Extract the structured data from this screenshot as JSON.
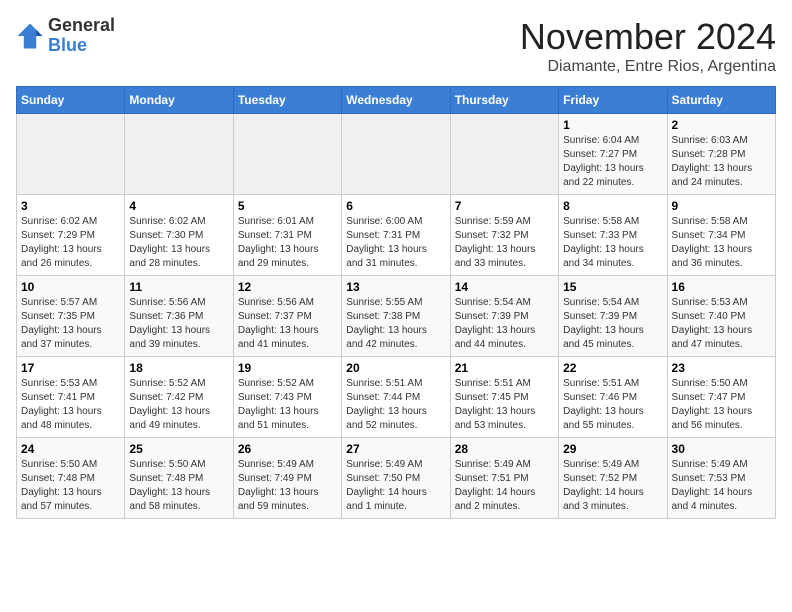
{
  "header": {
    "logo_general": "General",
    "logo_blue": "Blue",
    "title": "November 2024",
    "subtitle": "Diamante, Entre Rios, Argentina"
  },
  "weekdays": [
    "Sunday",
    "Monday",
    "Tuesday",
    "Wednesday",
    "Thursday",
    "Friday",
    "Saturday"
  ],
  "weeks": [
    [
      {
        "day": "",
        "info": ""
      },
      {
        "day": "",
        "info": ""
      },
      {
        "day": "",
        "info": ""
      },
      {
        "day": "",
        "info": ""
      },
      {
        "day": "",
        "info": ""
      },
      {
        "day": "1",
        "info": "Sunrise: 6:04 AM\nSunset: 7:27 PM\nDaylight: 13 hours and 22 minutes."
      },
      {
        "day": "2",
        "info": "Sunrise: 6:03 AM\nSunset: 7:28 PM\nDaylight: 13 hours and 24 minutes."
      }
    ],
    [
      {
        "day": "3",
        "info": "Sunrise: 6:02 AM\nSunset: 7:29 PM\nDaylight: 13 hours and 26 minutes."
      },
      {
        "day": "4",
        "info": "Sunrise: 6:02 AM\nSunset: 7:30 PM\nDaylight: 13 hours and 28 minutes."
      },
      {
        "day": "5",
        "info": "Sunrise: 6:01 AM\nSunset: 7:31 PM\nDaylight: 13 hours and 29 minutes."
      },
      {
        "day": "6",
        "info": "Sunrise: 6:00 AM\nSunset: 7:31 PM\nDaylight: 13 hours and 31 minutes."
      },
      {
        "day": "7",
        "info": "Sunrise: 5:59 AM\nSunset: 7:32 PM\nDaylight: 13 hours and 33 minutes."
      },
      {
        "day": "8",
        "info": "Sunrise: 5:58 AM\nSunset: 7:33 PM\nDaylight: 13 hours and 34 minutes."
      },
      {
        "day": "9",
        "info": "Sunrise: 5:58 AM\nSunset: 7:34 PM\nDaylight: 13 hours and 36 minutes."
      }
    ],
    [
      {
        "day": "10",
        "info": "Sunrise: 5:57 AM\nSunset: 7:35 PM\nDaylight: 13 hours and 37 minutes."
      },
      {
        "day": "11",
        "info": "Sunrise: 5:56 AM\nSunset: 7:36 PM\nDaylight: 13 hours and 39 minutes."
      },
      {
        "day": "12",
        "info": "Sunrise: 5:56 AM\nSunset: 7:37 PM\nDaylight: 13 hours and 41 minutes."
      },
      {
        "day": "13",
        "info": "Sunrise: 5:55 AM\nSunset: 7:38 PM\nDaylight: 13 hours and 42 minutes."
      },
      {
        "day": "14",
        "info": "Sunrise: 5:54 AM\nSunset: 7:39 PM\nDaylight: 13 hours and 44 minutes."
      },
      {
        "day": "15",
        "info": "Sunrise: 5:54 AM\nSunset: 7:39 PM\nDaylight: 13 hours and 45 minutes."
      },
      {
        "day": "16",
        "info": "Sunrise: 5:53 AM\nSunset: 7:40 PM\nDaylight: 13 hours and 47 minutes."
      }
    ],
    [
      {
        "day": "17",
        "info": "Sunrise: 5:53 AM\nSunset: 7:41 PM\nDaylight: 13 hours and 48 minutes."
      },
      {
        "day": "18",
        "info": "Sunrise: 5:52 AM\nSunset: 7:42 PM\nDaylight: 13 hours and 49 minutes."
      },
      {
        "day": "19",
        "info": "Sunrise: 5:52 AM\nSunset: 7:43 PM\nDaylight: 13 hours and 51 minutes."
      },
      {
        "day": "20",
        "info": "Sunrise: 5:51 AM\nSunset: 7:44 PM\nDaylight: 13 hours and 52 minutes."
      },
      {
        "day": "21",
        "info": "Sunrise: 5:51 AM\nSunset: 7:45 PM\nDaylight: 13 hours and 53 minutes."
      },
      {
        "day": "22",
        "info": "Sunrise: 5:51 AM\nSunset: 7:46 PM\nDaylight: 13 hours and 55 minutes."
      },
      {
        "day": "23",
        "info": "Sunrise: 5:50 AM\nSunset: 7:47 PM\nDaylight: 13 hours and 56 minutes."
      }
    ],
    [
      {
        "day": "24",
        "info": "Sunrise: 5:50 AM\nSunset: 7:48 PM\nDaylight: 13 hours and 57 minutes."
      },
      {
        "day": "25",
        "info": "Sunrise: 5:50 AM\nSunset: 7:48 PM\nDaylight: 13 hours and 58 minutes."
      },
      {
        "day": "26",
        "info": "Sunrise: 5:49 AM\nSunset: 7:49 PM\nDaylight: 13 hours and 59 minutes."
      },
      {
        "day": "27",
        "info": "Sunrise: 5:49 AM\nSunset: 7:50 PM\nDaylight: 14 hours and 1 minute."
      },
      {
        "day": "28",
        "info": "Sunrise: 5:49 AM\nSunset: 7:51 PM\nDaylight: 14 hours and 2 minutes."
      },
      {
        "day": "29",
        "info": "Sunrise: 5:49 AM\nSunset: 7:52 PM\nDaylight: 14 hours and 3 minutes."
      },
      {
        "day": "30",
        "info": "Sunrise: 5:49 AM\nSunset: 7:53 PM\nDaylight: 14 hours and 4 minutes."
      }
    ]
  ]
}
